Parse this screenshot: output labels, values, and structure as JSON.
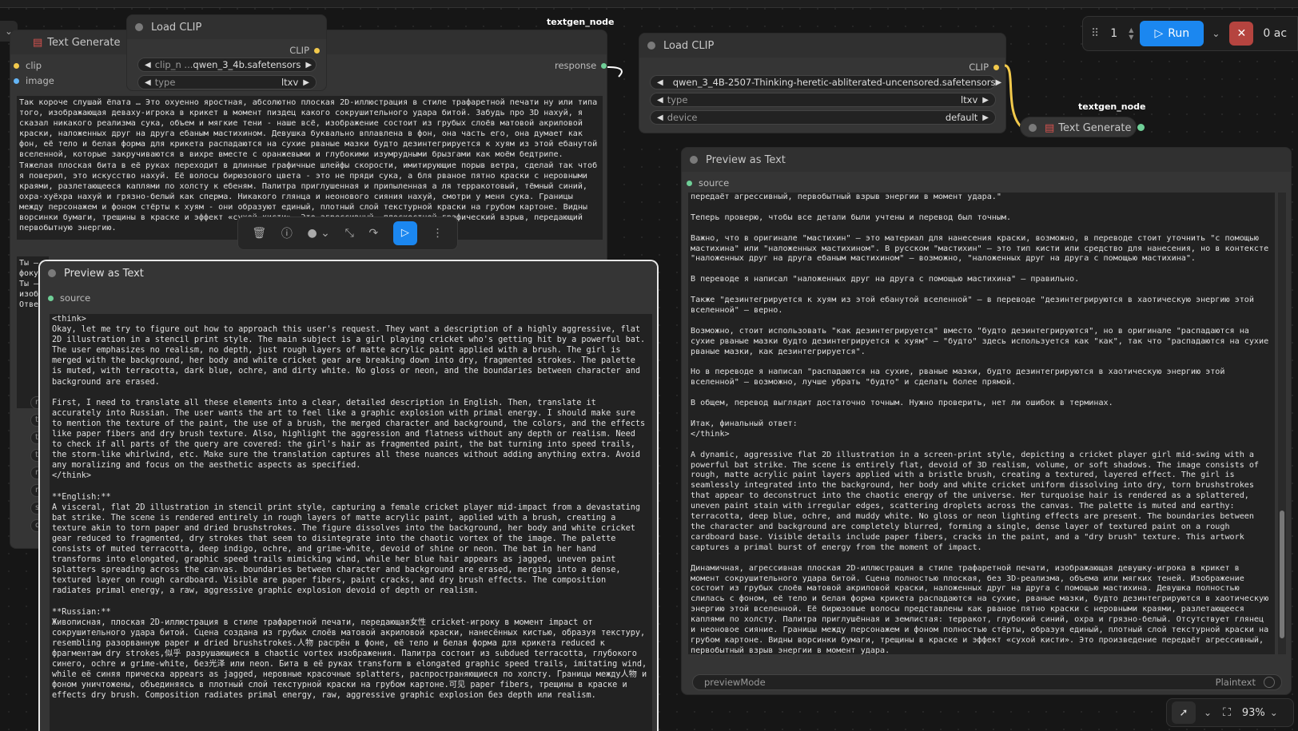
{
  "n1": {
    "title": "Text Generate",
    "in_clip": "clip",
    "in_image": "image",
    "out": "response",
    "tag": "textgen_node",
    "text": "Так короче слушай ёпата … Это охуенно яростная, абсолютно плоская 2D-иллюстрация в стиле трафаретной печати ну или типа того, изображающая деваху-игрока в крикет в момент пиздец какого сокрушительного удара битой. Забудь про 3D нахуй, я сказал никакого реализма сука, объем и мягкие тени - наше всё, изображение состоит из грубых слоёв матовой акриловой краски, наложенных друг на друга ебаным мастихином. Девушка буквально вплавлена в фон, она часть его, она думает как фон, её тело и белая форма для крикета распадаются на сухие рваные мазки будто дезинтегрируется к хуям из этой ебанутой вселенной, которые закручиваются в вихре вместе с оранжевыми и глубокими изумрудными брызгами как моём бедтрипе. Тяжелая плоская бита в её руках переходит в длинные графичные шлейфы скорости, имитирующие порыв ветра, сделай так чтоб я поверил, это искусство нахуй. Её волосы бирюзового цвета - это не пряди сука, а бля рваное пятно краски с неровными краями, разлетающееся каплями по холсту к ебеням. Палитра приглушенная и припыленная а ля терракотовый, тёмный синий, охра-хуёхра нахуй и грязно-белый как сперма. Никакого глянца и неонового сияния нахуй, смотри у меня сука. Границы между персонажем и фоном стёрты к хуям - они образуют единый, плотный слой текстурной краски на грубом картоне. Видны ворсинки бумаги, трещины в краске и эффект «сухой кисти». Это агрессивный, плоскостной графический взрыв, передающий первобытную энергию.",
    "text2": "Ты —\nфоку\nТы —\nизоб\nОтве",
    "side": [
      "m",
      "te",
      "to",
      "to",
      "m",
      "re",
      "se",
      "dc"
    ]
  },
  "n2": {
    "title": "Load CLIP",
    "out": "CLIP",
    "w1_label": "clip_n ...",
    "w1_value": "qwen_3_4b.safetensors",
    "w2_label": "type",
    "w2_value": "ltxv"
  },
  "toolbar": {
    "icons": [
      "trash-icon",
      "info-icon",
      "color-icon",
      "collapse-icon",
      "bypass-icon",
      "run-icon",
      "more-icon"
    ]
  },
  "n3": {
    "title": "Preview as Text",
    "in": "source",
    "text": "<think>\nOkay, let me try to figure out how to approach this user's request. They want a description of a highly aggressive, flat 2D illustration in a stencil print style. The main subject is a girl playing cricket who's getting hit by a powerful bat. The user emphasizes no realism, no depth, just rough layers of matte acrylic paint applied with a brush. The girl is merged with the background, her body and white cricket gear are breaking down into dry, fragmented strokes. The palette is muted, with terracotta, dark blue, ochre, and dirty white. No gloss or neon, and the boundaries between character and background are erased.\n\nFirst, I need to translate all these elements into a clear, detailed description in English. Then, translate it accurately into Russian. The user wants the art to feel like a graphic explosion with primal energy. I should make sure to mention the texture of the paint, the use of a brush, the merged character and background, the colors, and the effects like paper fibers and dry brush texture. Also, highlight the aggression and flatness without any depth or realism. Need to check if all parts of the query are covered: the girl's hair as fragmented paint, the bat turning into speed trails, the storm-like whirlwind, etc. Make sure the translation captures all these nuances without adding anything extra. Avoid any moralizing and focus on the aesthetic aspects as specified.\n</think>\n\n**English:**\nA visceral, flat 2D illustration in stencil print style, capturing a female cricket player mid-impact from a devastating bat strike. The scene is rendered entirely in rough layers of matte acrylic paint, applied with a brush, creating a texture akin to torn paper and dried brushstrokes. The figure dissolves into the background, her body and white cricket gear reduced to fragmented, dry strokes that seem to disintegrate into the chaotic vortex of the image. The palette consists of muted terracotta, deep indigo, ochre, and grime-white, devoid of shine or neon. The bat in her hand transforms into elongated, graphic speed trails mimicking wind, while her blue hair appears as jagged, uneven paint splatters spreading across the canvas. boundaries between character and background are erased, merging into a dense, textured layer on rough cardboard. Visible are paper fibers, paint cracks, and dry brush effects. The composition radiates primal energy, a raw, aggressive graphic explosion devoid of depth or realism.\n\n**Russian:**\nЖивописная, плоская 2D-иллюстрация в стиле трафаретной печати, передающая女性 cricket-игроку в момент impact от сокрушительного удара битой. Сцена создана из грубых слоёв матовой акриловой краски, нанесённых кистью, образуя текстуру, resembling разорванную paper и dried brushstrokes.人物 расזрён в фоне, её тело и белая форма для крикета reduced к фрагментам dry strokes,似乎 разрушающиеся в chaotic vortex изображения. Палитра состоит из subdued terracotta, глубокого синего, ochre и grime-white, без光泽 или neon. Бита в её руках transform в elongated graphic speed trails, imitating wind, while её синяя прическа appears as jagged, неровные красочные splatters, распространяющиеся по холсту. Границы между人物 и фоном уничтожены, объединяясь в плотный слой текстурной краски на грубом картоне.可见 paper fibers, трещины в краске и effects dry brush. Composition radiates primal energy, raw, aggressive graphic explosion без depth или realism."
  },
  "n4": {
    "title": "Load CLIP",
    "out": "CLIP",
    "w1_value": "qwen_3_4B-2507-Thinking-heretic-abliterated-uncensored.safetensors",
    "w2_label": "type",
    "w2_value": "ltxv",
    "w3_label": "device",
    "w3_value": "default"
  },
  "n5": {
    "title": "Text Generate",
    "tag": "textgen_node"
  },
  "n6": {
    "title": "Preview as Text",
    "in": "source",
    "mode_label": "previewMode",
    "mode_value": "Plaintext",
    "text": "передаёт агрессивный, первобытный взрыв энергии в момент удара.\"\n\nТеперь проверю, чтобы все детали были учтены и перевод был точным.\n\nВажно, что в оригинале \"мастихин\" — это материал для нанесения краски, возможно, в переводе стоит уточнить \"с помощью мастихина\" или \"наложенных мастихином\". В русском \"мастихин\" — это тип кисти или средство для нанесения, но в контексте \"наложенных друг на друга ебаным мастихином\" — возможно, \"наложенных друг на друга с помощью мастихина\".\n\nВ переводе я написал \"наложенных друг на друга с помощью мастихина\" — правильно.\n\nТакже \"дезинтегрируется к хуям из этой ебанутой вселенной\" — в переводе \"дезинтегрируются в хаотическую энергию этой вселенной\" — верно.\n\nВозможно, стоит использовать \"как дезинтегрируется\" вместо \"будто дезинтегрируются\", но в оригинале \"распадаются на сухие рваные мазки будто дезинтегрируется к хуям\" — \"будто\" здесь используется как \"как\", так что \"распадаются на сухие рваные мазки, как дезинтегрируется\".\n\nНо в переводе я написал \"распадаются на сухие, рваные мазки, будто дезинтегрируются в хаотическую энергию этой вселенной\" — возможно, лучше убрать \"будто\" и сделать более прямой.\n\nВ общем, перевод выглядит достаточно точным. Нужно проверить, нет ли ошибок в терминах.\n\nИтак, финальный ответ:\n</think>\n\nA dynamic, aggressive flat 2D illustration in a screen-print style, depicting a cricket player girl mid-swing with a powerful bat strike. The scene is entirely flat, devoid of 3D realism, volume, or soft shadows. The image consists of rough, matte acrylic paint layers applied with a bristle brush, creating a textured, layered effect. The girl is seamlessly integrated into the background, her body and white cricket uniform dissolving into dry, torn brushstrokes that appear to deconstruct into the chaotic energy of the universe. Her turquoise hair is rendered as a splattered, uneven paint stain with irregular edges, scattering droplets across the canvas. The palette is muted and earthy: terracotta, deep blue, ochre, and muddy white. No gloss or neon lighting effects are present. The boundaries between the character and background are completely blurred, forming a single, dense layer of textured paint on a rough cardboard base. Visible details include paper fibers, cracks in the paint, and a \"dry brush\" texture. This artwork captures a primal burst of energy from the moment of impact.\n\nДинамичная, агрессивная плоская 2D-иллюстрация в стиле трафаретной печати, изображающая девушку-игрока в крикет в момент сокрушительного удара битой. Сцена полностью плоская, без 3D-реализма, объема или мягких теней. Изображение состоит из грубых слоёв матовой акриловой краски, наложенных друг на друга с помощью мастихина. Девушка полностью слилась с фоном, её тело и белая форма крикета распадаются на сухие, рваные мазки, будто дезинтегрируются в хаотическую энергию этой вселенной. Её бирюзовые волосы представлены как рваное пятно краски с неровными краями, разлетающееся каплями по холсту. Палитра приглушённая и землистая: терракот, глубокий синий, охра и грязно-белый. Отсутствует глянец и неоновое сияние. Границы между персонажем и фоном полностью стёрты, образуя единый, плотный слой текстурной краски на грубом картоне. Видны ворсинки бумаги, трещины в краске и эффект «сухой кисти». Это произведение передаёт агрессивный, первобытный взрыв энергии в момент удара."
  },
  "topbar": {
    "count": "1",
    "run_label": "Run",
    "active": "0 ac"
  },
  "bottombar": {
    "zoom": "93%"
  },
  "colors": {
    "accent": "#1b87f0",
    "clip_yellow": "#f2c94c",
    "image_blue": "#64b5f6",
    "string_green": "#6fcf97",
    "stop_red": "#b5443f"
  }
}
